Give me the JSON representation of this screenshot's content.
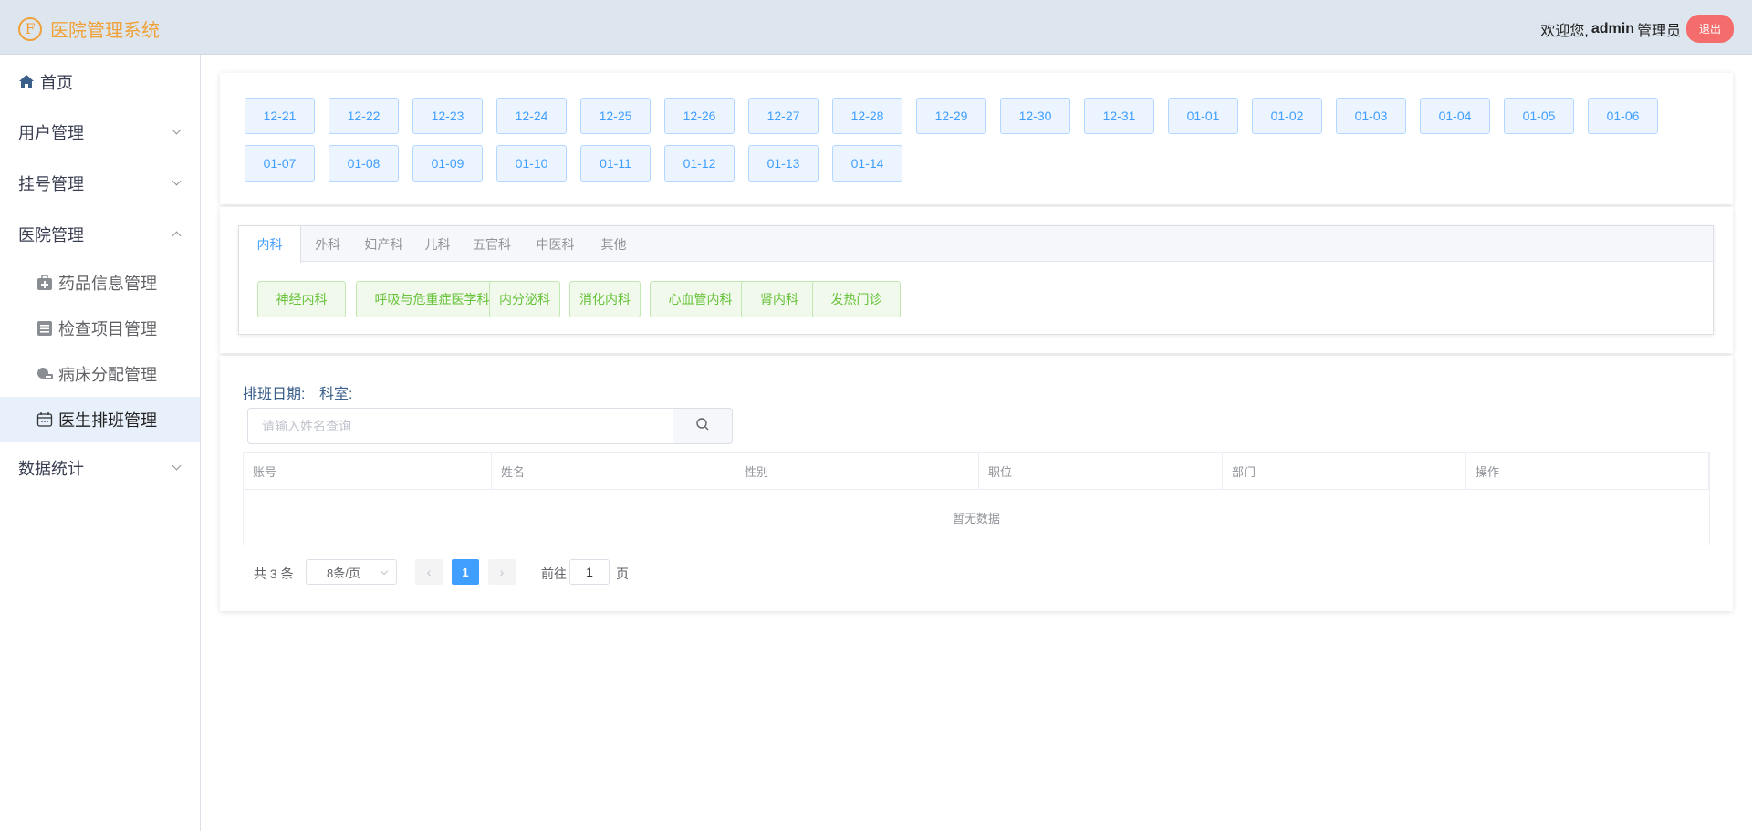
{
  "header": {
    "app_title": "医院管理系统",
    "logo_letter": "F",
    "welcome": "欢迎您,",
    "username": "admin",
    "role": "管理员",
    "logout": "退出"
  },
  "sidebar": {
    "home": "首页",
    "user_mgmt": "用户管理",
    "register_mgmt": "挂号管理",
    "hospital_mgmt": "医院管理",
    "hospital_sub": [
      "药品信息管理",
      "检查项目管理",
      "病床分配管理",
      "医生排班管理"
    ],
    "stats": "数据统计"
  },
  "dates": [
    "12-21",
    "12-22",
    "12-23",
    "12-24",
    "12-25",
    "12-26",
    "12-27",
    "12-28",
    "12-29",
    "12-30",
    "12-31",
    "01-01",
    "01-02",
    "01-03",
    "01-04",
    "01-05",
    "01-06",
    "01-07",
    "01-08",
    "01-09",
    "01-10",
    "01-11",
    "01-12",
    "01-13",
    "01-14"
  ],
  "dept_tabs": [
    "内科",
    "外科",
    "妇产科",
    "儿科",
    "五官科",
    "中医科",
    "其他"
  ],
  "dept_buttons": [
    "神经内科",
    "呼吸与危重症医学科",
    "内分泌科",
    "消化内科",
    "心血管内科",
    "肾内科",
    "发热门诊"
  ],
  "filter": {
    "date_label": "排班日期:",
    "dept_label": "科室:",
    "search_placeholder": "请输入姓名查询"
  },
  "table": {
    "columns": [
      "账号",
      "姓名",
      "性别",
      "职位",
      "部门",
      "操作"
    ],
    "empty_text": "暂无数据"
  },
  "pagination": {
    "total": "共 3 条",
    "page_size": "8条/页",
    "current_page": "1",
    "goto_label": "前往",
    "goto_value": "1",
    "page_label": "页"
  },
  "colors": {
    "accent": "#409eff",
    "success": "#67c23a",
    "danger": "#f56c6c",
    "logo": "#f0a23a"
  }
}
